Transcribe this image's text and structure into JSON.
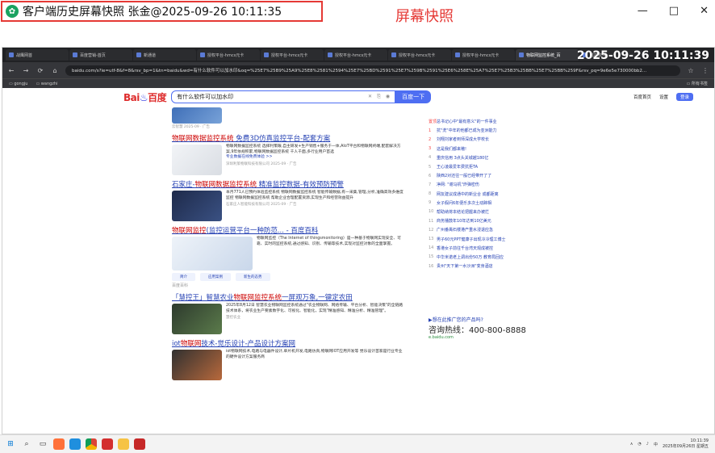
{
  "snapshot": {
    "title": "客户端历史屏幕快照 张金@2025-09-26 10:11:35",
    "label": "屏幕快照",
    "minimize": "—",
    "maximize": "□",
    "close": "✕"
  },
  "browser": {
    "overlay_time": "2025-09-26 10:11:39",
    "tabs": [
      {
        "label": "战鹰网首"
      },
      {
        "label": "百度营销-首页"
      },
      {
        "label": "新通道"
      },
      {
        "label": "授权平台-hmcs元卡"
      },
      {
        "label": "授权平台-hmcs元卡"
      },
      {
        "label": "授权平台-hmcs元卡"
      },
      {
        "label": "授权平台-hmcs元卡"
      },
      {
        "label": "授权平台-hmcs元卡"
      },
      {
        "label": "物联网监控系统_百"
      },
      {
        "label": "监控软件"
      }
    ],
    "url": "baidu.com/s?ie=utf-8&f=8&rsv_bp=1&tn=baidu&wd=有什么软件可以加水印&oq=%25E7%25B9%25A9%25E8%2581%2594%25E7%25BD%2591%25E7%259B%2591%25E6%258E%25A7%25E7%25B3%25BB%25E7%25BB%259F&rsv_pq=9e6e5e730000bb2...",
    "bookmarks": [
      "gongju",
      "wangzhi"
    ],
    "bookmarks_right": "所有书签"
  },
  "baidu": {
    "query": "有什么软件可以加水印",
    "search_button": "百度一下",
    "header_links": [
      "百度首页",
      "设置"
    ],
    "login": "登录",
    "results": [
      {
        "meta": "云智慧 2025-09 · 广告"
      },
      {
        "title_pre": "",
        "title_hl": "物联网数据监控系统",
        "title_post": " 免费3D仿真监控平台-配套方案",
        "snippet": "物联网数据监控系统 选择利策眼,自主研发+生产销售+服务于一体,AIoT平台和物联网终端,配套解决方案,9年依规积累,物联网数据监控系统 千人千面,多行业用户首选",
        "link": "专业数据在线免费体验 >>",
        "meta": "深圳利策物联科技有限公司 2025-09 · 广告"
      },
      {
        "title_pre": "石家庄-",
        "title_hl": "物联网数据监控系统",
        "title_post": " 精准监控数据-有效预防预警",
        "snippet": "本月771人已预约体验监控系统 物联网数据监控系统 智能传输数据,有一采集,管理,分析,准确高效多维度监控 物联网数据监控系统 帮助企业合理配置资源,实现生产和经营效益提升",
        "meta": "石家庄人智能科技有限公司 2025-09 · 广告"
      },
      {
        "title_pre": "",
        "title_hl": "物联网监控",
        "title_post": "(监控运营平台一种防范... - 百度百科",
        "snippet": "物联网监控（The Internet of thingsmonitoring）是一种基于物联网实现安全、可靠、实时的监控系统,通过感知、识别、传输等技术,实现对监控对象的全面掌握。",
        "tags": [
          "简介",
          "应用案例",
          "新生的态势"
        ],
        "meta": "百度百科"
      },
      {
        "title_pre": "「慧控王」智慧农业",
        "title_hl": "物联网监控系统",
        "title_post": "一屏观万象,一键定农田",
        "snippet": "2025年8月12日 智慧农业物联网监控系统通过\"农业物联网、网络传输、平台分析、智能决策\"的全链路技术体系，将农业生产要素数字化、可视化、智能化，实现\"精准感知、精准分析、精准管理\"。",
        "meta": "慧控农业"
      },
      {
        "title_pre": "iot",
        "title_hl": "物联网",
        "title_post": "技术-觉乐设计-产品设计方案网",
        "snippet": "iot物联网技术,电路与电器件设计,单片机开发,电路仿真,物联网IOT应用开发等 觉乐设计首家是行业专业的硬件设计方案服务商"
      }
    ],
    "hot_list": [
      {
        "no": "置顶",
        "text": "总书记心中\"最有意义\"的一件事业"
      },
      {
        "no": "1",
        "text": "抗\"洗\"中年的他都已成为亚洲能力"
      },
      {
        "no": "2",
        "text": "刘翔刘家者到师深成大学校长"
      },
      {
        "no": "3",
        "text": "这是我们都来嗷!"
      },
      {
        "no": "4",
        "text": "重庆信用 3点头关城越180亿"
      },
      {
        "no": "5",
        "text": "王心凌最爱年费抗拒TA"
      },
      {
        "no": "6",
        "text": "陕西2对还往一般已经带开了了"
      },
      {
        "no": "7",
        "text": "净网: \"谢马机\"炸弹密伤"
      },
      {
        "no": "8",
        "text": "网友建议成通中的新业合 成都距离"
      },
      {
        "no": "9",
        "text": "女子假问6年便乐多次土动蹄相"
      },
      {
        "no": "10",
        "text": "帮助纳将本结论把握来办被拦"
      },
      {
        "no": "11",
        "text": "商务播鼓年10年达到10亿美元"
      },
      {
        "no": "12",
        "text": "广州番禺石楼港产重水浸退应急"
      },
      {
        "no": "13",
        "text": "男子60元PPT健康子出现冷冷理工博士"
      },
      {
        "no": "14",
        "text": "香港女子前往千台湾天观成被控"
      },
      {
        "no": "15",
        "text": "中华米诺老上调出份50万 教育局回应"
      },
      {
        "no": "16",
        "text": "贵州\"天下第一水沙洲\"变身酒店"
      }
    ],
    "ad": {
      "title": "▶想在此推广您的产品吗?",
      "phone": "咨询热线：400-800-8888",
      "url": "e.baidu.com"
    }
  },
  "taskbar": {
    "time": "10:11:39",
    "date": "2025年09月26日 星期五"
  }
}
